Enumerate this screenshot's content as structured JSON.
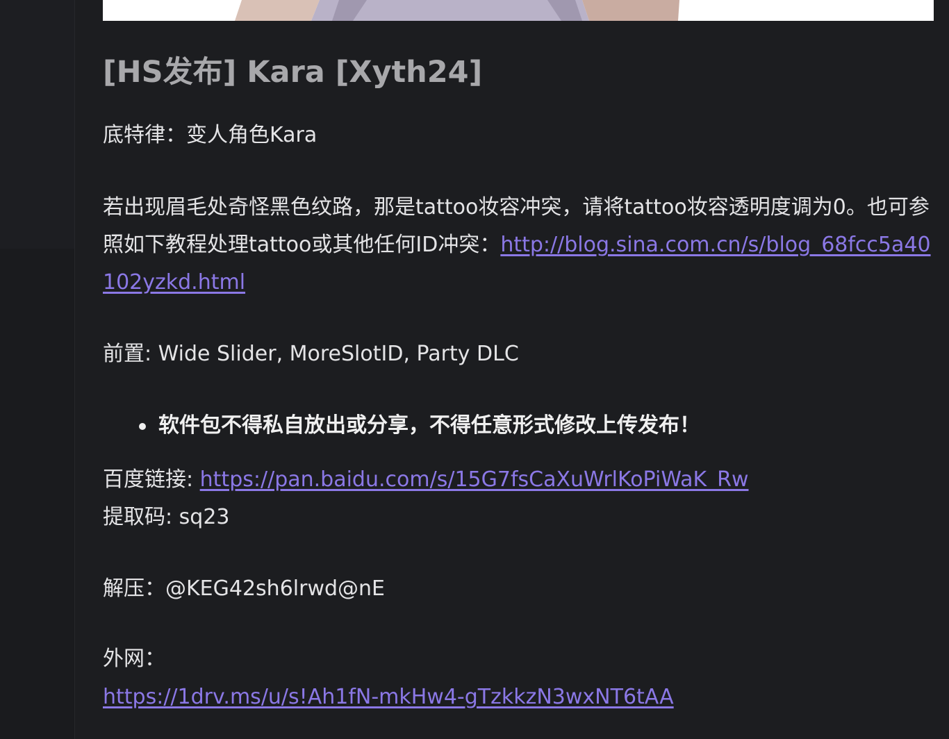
{
  "post": {
    "title": "[HS发布] Kara [Xyth24]",
    "line1": "底特律：变人角色Kara",
    "notice_text": "若出现眉毛处奇怪黑色纹路，那是tattoo妆容冲突，请将tattoo妆容透明度调为0。也可参照如下教程处理tattoo或其他任何ID冲突：",
    "tutorial_link": "http://blog.sina.com.cn/s/blog_68fcc5a40102yzkd.html",
    "prereq": "前置: Wide Slider, MoreSlotID, Party DLC",
    "warning_bullet": "软件包不得私自放出或分享，不得任意形式修改上传发布！",
    "baidu_label": "百度链接: ",
    "baidu_link": "https://pan.baidu.com/s/15G7fsCaXuWrlKoPiWaK_Rw",
    "extract_code": "提取码: sq23",
    "unzip": "解压：@KEG42sh6lrwd@nE",
    "external_label": "外网：",
    "onedrive_link": "https://1drv.ms/u/s!Ah1fN-mkHw4-gTzkkzN3wxNT6tAA"
  },
  "colors": {
    "background": "#1c1d20",
    "link": "#8b78e6",
    "title": "#a8a8ab",
    "text": "#e4e4e6"
  }
}
